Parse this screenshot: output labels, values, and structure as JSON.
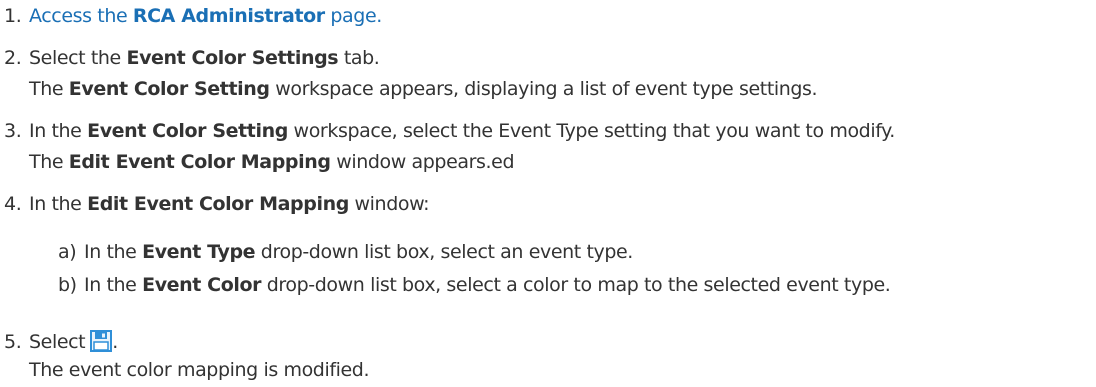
{
  "steps": [
    {
      "number": "1.",
      "prefix": "Access the ",
      "link_bold": "RCA Administrator",
      "suffix": " page."
    },
    {
      "number": "2.",
      "prefix": "Select the ",
      "bold": "Event Color Settings",
      "suffix": " tab.",
      "result_bold": "Event Color Setting",
      "result_suffix": " workspace appears, displaying a list of event type settings.",
      "result_prefix": "The "
    },
    {
      "number": "3.",
      "prefix": "In the ",
      "bold": "Event Color Setting",
      "suffix": " workspace, select the Event Type setting that you want to modify.",
      "result_prefix": "The ",
      "result_bold": "Edit Event Color Mapping",
      "result_suffix": " window appears.ed"
    },
    {
      "number": "4.",
      "prefix": "In the ",
      "bold": "Edit Event Color Mapping",
      "suffix": " window:",
      "substeps": [
        {
          "label": "a)",
          "prefix": "In the ",
          "bold": "Event Type",
          "suffix": " drop-down list box, select an event type."
        },
        {
          "label": "b)",
          "prefix": "In the ",
          "bold": "Event Color",
          "suffix": " drop-down list box, select a color to map to the selected event type."
        }
      ]
    },
    {
      "number": "5.",
      "prefix": "Select",
      "icon": "save-icon",
      "suffix": ".",
      "result": "The event color mapping is modified."
    }
  ],
  "colors": {
    "text": "#333333",
    "link": "#1a6fb5",
    "icon": "#2f8fd8"
  }
}
